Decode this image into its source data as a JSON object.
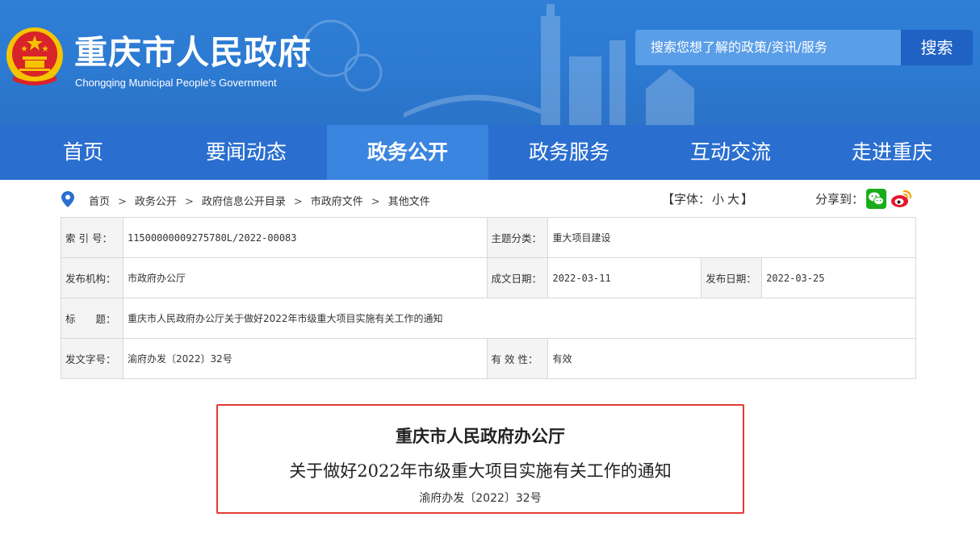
{
  "header": {
    "title": "重庆市人民政府",
    "subtitle": "Chongqing Municipal People's Government",
    "search_placeholder": "搜索您想了解的政策/资讯/服务",
    "search_button": "搜索"
  },
  "nav": {
    "items": [
      {
        "label": "首页"
      },
      {
        "label": "要闻动态"
      },
      {
        "label": "政务公开",
        "active": true
      },
      {
        "label": "政务服务"
      },
      {
        "label": "互动交流"
      },
      {
        "label": "走进重庆"
      }
    ]
  },
  "breadcrumb": [
    "首页",
    "政务公开",
    "政府信息公开目录",
    "市政府文件",
    "其他文件"
  ],
  "breadcrumb_sep": ">",
  "font_size": {
    "prefix": "【字体：",
    "small": "小",
    "large": "大",
    "suffix": "】"
  },
  "share": {
    "label": "分享到："
  },
  "info": {
    "index_label": "索 引 号：",
    "index_value": "11500000009275780L/2022-00083",
    "topic_label": "主题分类：",
    "topic_value": "重大项目建设",
    "issuer_label": "发布机构：",
    "issuer_value": "市政府办公厅",
    "written_label": "成文日期：",
    "written_value": "2022-03-11",
    "published_label": "发布日期：",
    "published_value": "2022-03-25",
    "title_label": "标　　题：",
    "title_value": "重庆市人民政府办公厅关于做好2022年市级重大项目实施有关工作的通知",
    "docno_label": "发文字号：",
    "docno_value": "渝府办发〔2022〕32号",
    "validity_label": "有 效 性：",
    "validity_value": "有效"
  },
  "document": {
    "org": "重庆市人民政府办公厅",
    "title": "关于做好2022年市级重大项目实施有关工作的通知",
    "number": "渝府办发〔2022〕32号"
  },
  "colors": {
    "header_blue": "#2c7ad2",
    "nav_blue": "#2a6fd0",
    "nav_active": "#3a85e0",
    "search_button": "#1f62c4",
    "highlight_red": "#e53935",
    "emblem_red": "#d8232a",
    "emblem_gold": "#f5c400",
    "wechat_green": "#1aad19",
    "weibo_red": "#e6162d"
  },
  "icons": {
    "emblem": "national-emblem-icon",
    "location": "location-pin-icon",
    "wechat": "wechat-icon",
    "weibo": "weibo-icon"
  }
}
